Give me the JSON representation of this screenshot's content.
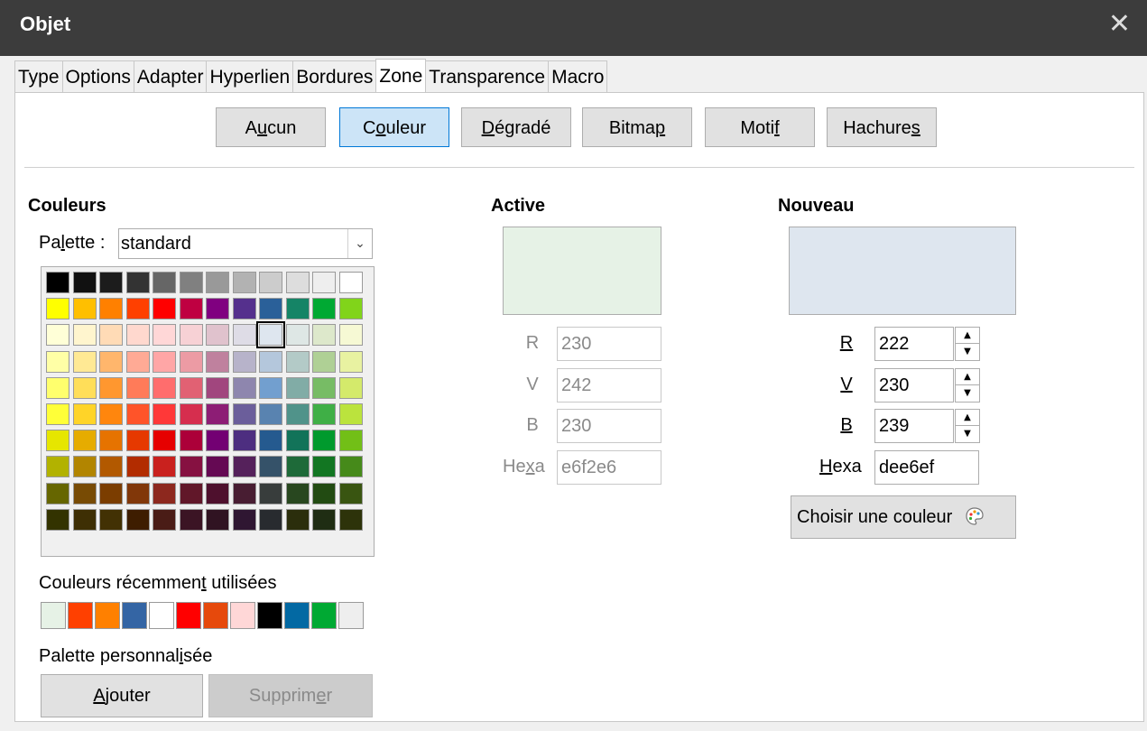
{
  "window": {
    "title": "Objet",
    "close": "✕"
  },
  "tabs": [
    "Type",
    "Options",
    "Adapter",
    "Hyperlien",
    "Bordures",
    "Zone",
    "Transparence",
    "Macro"
  ],
  "active_tab": "Zone",
  "fill_buttons": [
    {
      "pre": "A",
      "ul": "u",
      "post": "cun"
    },
    {
      "pre": "C",
      "ul": "o",
      "post": "uleur"
    },
    {
      "pre": "",
      "ul": "D",
      "post": "égradé"
    },
    {
      "pre": "Bitma",
      "ul": "p",
      "post": ""
    },
    {
      "pre": "Moti",
      "ul": "f",
      "post": ""
    },
    {
      "pre": "Hachure",
      "ul": "s",
      "post": ""
    }
  ],
  "active_fill": "Couleur",
  "colors_section": {
    "header": "Couleurs",
    "palette_label": {
      "pre": "Pa",
      "ul": "l",
      "post": "ette :"
    },
    "palette_value": "standard",
    "recent_label": {
      "pre": "Couleurs récemmen",
      "ul": "t",
      "post": " utilisées"
    },
    "custom_label": {
      "pre": "Palette personnal",
      "ul": "i",
      "post": "sée"
    },
    "add_button": {
      "pre": "",
      "ul": "A",
      "post": "jouter"
    },
    "remove_button": {
      "pre": "Supprim",
      "ul": "e",
      "post": "r"
    }
  },
  "swatches": [
    [
      "#000000",
      "#111111",
      "#1c1c1c",
      "#333333",
      "#666666",
      "#808080",
      "#999999",
      "#b2b2b2",
      "#cccccc",
      "#dddddd",
      "#eeeeee",
      "#ffffff"
    ],
    [
      "#ffff00",
      "#ffbf00",
      "#ff8000",
      "#ff4000",
      "#ff0000",
      "#bf0041",
      "#800080",
      "#55308d",
      "#2a6099",
      "#158466",
      "#00a933",
      "#81d41a"
    ],
    [
      "#ffffd7",
      "#fff5ce",
      "#ffdbb6",
      "#ffd8ce",
      "#ffd7d7",
      "#f7d1d5",
      "#e0c2cd",
      "#dedce6",
      "#dee6ef",
      "#dee7e5",
      "#dde8cb",
      "#f6f9d4"
    ],
    [
      "#ffffa6",
      "#ffe994",
      "#ffb66c",
      "#ffaa95",
      "#ffa6a6",
      "#ec9ba4",
      "#bf819e",
      "#b7b3ca",
      "#b4c7dc",
      "#b3cac7",
      "#afd095",
      "#e8f2a1"
    ],
    [
      "#ffff6d",
      "#ffde59",
      "#ff972f",
      "#ff7b59",
      "#ff6d6d",
      "#e16173",
      "#a1467e",
      "#8e86ae",
      "#729fcf",
      "#81aca6",
      "#77bc65",
      "#d4ea6b"
    ],
    [
      "#ffff38",
      "#ffd428",
      "#ff860d",
      "#ff5429",
      "#ff3838",
      "#d62e4e",
      "#8d1d75",
      "#6b5e9b",
      "#5983b0",
      "#50938a",
      "#3faf46",
      "#bbe33d"
    ],
    [
      "#e6e600",
      "#e6ac00",
      "#e67300",
      "#e63900",
      "#e60000",
      "#ac0039",
      "#730073",
      "#4d2e80",
      "#255a8f",
      "#127359",
      "#009a2d",
      "#72bf17"
    ],
    [
      "#b2b200",
      "#b28500",
      "#b25900",
      "#b22c00",
      "#c9211e",
      "#861141",
      "#650953",
      "#55215b",
      "#355269",
      "#1e6a39",
      "#127622",
      "#468a1a"
    ],
    [
      "#666600",
      "#784b04",
      "#7b3d00",
      "#813709",
      "#8d281e",
      "#611729",
      "#4e102d",
      "#481d32",
      "#383d3c",
      "#28471f",
      "#224b12",
      "#395511"
    ],
    [
      "#333300",
      "#3e2f04",
      "#423104",
      "#3e1d00",
      "#4a1c16",
      "#3b1424",
      "#301322",
      "#2f1632",
      "#282b2f",
      "#2b2e0c",
      "#1f2d13",
      "#2d330a"
    ]
  ],
  "selected_swatch": "#dee6ef",
  "recent_colors": [
    "#e6f2e6",
    "#ff4000",
    "#ff8000",
    "#3465a4",
    "#ffffff",
    "#ff0000",
    "#e6490c",
    "#ffd7d7",
    "#000000",
    "#0369a3",
    "#00a933",
    "#eeeeee"
  ],
  "active": {
    "header": "Active",
    "color": "#e6f2e6",
    "r_label": "R",
    "r": "230",
    "v_label": "V",
    "v": "242",
    "b_label": "B",
    "b": "230",
    "hex_label": {
      "pre": "He",
      "ul": "x",
      "post": "a"
    },
    "hex": "e6f2e6"
  },
  "nouveau": {
    "header": "Nouveau",
    "color": "#dee6ef",
    "r_label": "R",
    "r": "222",
    "v_label": "V",
    "v": "230",
    "b_label": "B",
    "b": "239",
    "hex_label": {
      "pre": "",
      "ul": "H",
      "post": "exa"
    },
    "hex": "dee6ef",
    "pick_button": "Choisir une couleur"
  }
}
